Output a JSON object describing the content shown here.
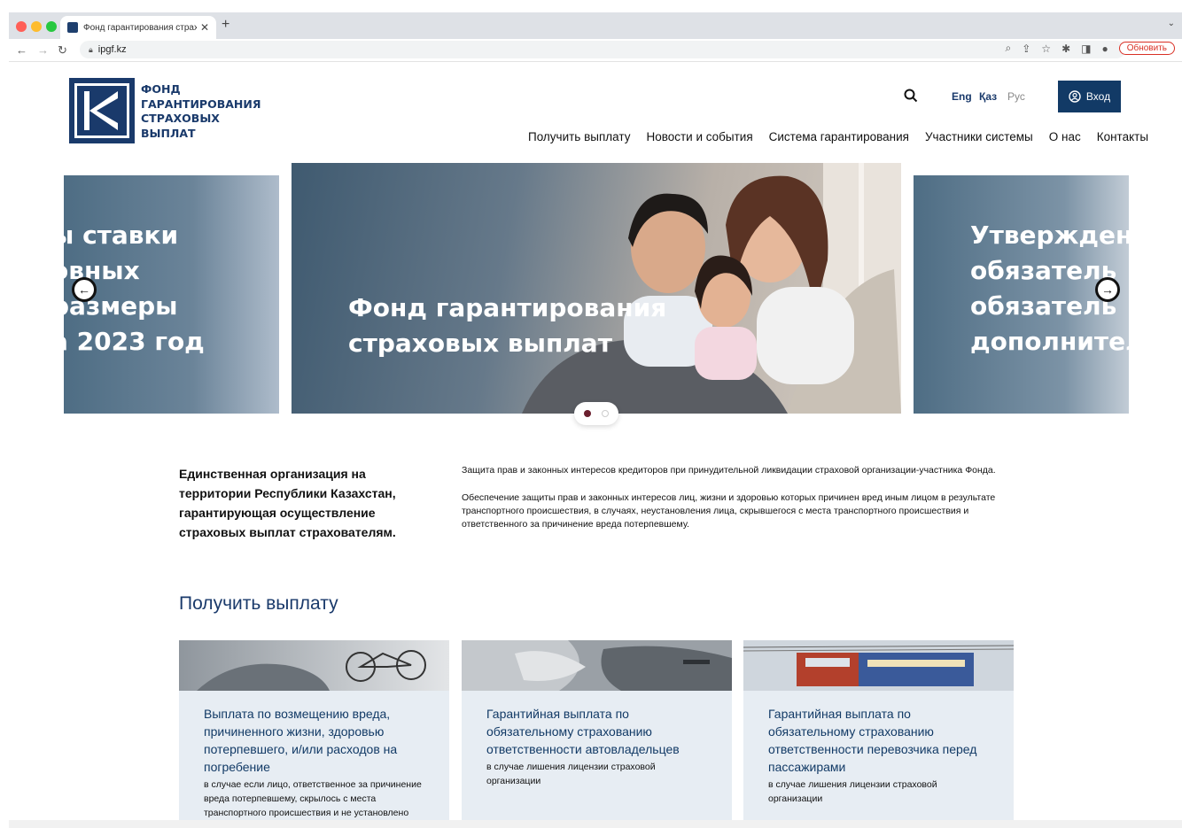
{
  "browser": {
    "tab_title": "Фонд гарантирования страх",
    "url": "ipgf.kz",
    "update_label": "Обновить"
  },
  "logo": {
    "line1": "ФОНД",
    "line2": "ГАРАНТИРОВАНИЯ",
    "line3": "СТРАХОВЫХ",
    "line4": "ВЫПЛАТ"
  },
  "languages": [
    "Eng",
    "Қаз",
    "Рус"
  ],
  "login_label": "Вход",
  "menu": [
    "Получить выплату",
    "Новости и события",
    "Система гарантирования",
    "Участники системы",
    "О нас",
    "Контакты"
  ],
  "carousel": {
    "left_lines": [
      "ы ставки",
      "овных",
      "размеры",
      "а 2023 год"
    ],
    "main_lines": [
      "Фонд гарантирования",
      "страховых выплат"
    ],
    "right_lines": [
      "Утвержден",
      "обязатель",
      "обязатель",
      "дополнител"
    ],
    "active_dot": 1
  },
  "intro": {
    "heading": "Единственная организация на территории Республики Казахстан, гарантирующая осуществление страховых выплат страхователям.",
    "para1": "Защита прав и законных интересов кредиторов при принудительной ликвидации страховой организации-участника Фонда.",
    "para2": "Обеспечение защиты прав и законных интересов лиц, жизни и здоровью которых причинен вред иным лицом в результате транспортного происшествия, в случаях, неустановления лица, скрывшегося с места транспортного происшествия и   ответственного за причинение вреда потерпевшему."
  },
  "section_title": "Получить выплату",
  "cards": [
    {
      "title": "Выплата по возмещению вреда, причиненного жизни, здоровью потерпевшего, и/или расходов на погребение",
      "subtitle": "в случае если лицо, ответственное за причинение вреда потерпевшему, скрылось с места транспортного происшествия и не установлено"
    },
    {
      "title": "Гарантийная выплата по обязательному страхованию ответственности автовладельцев",
      "subtitle": "в случае лишения лицензии страховой организации"
    },
    {
      "title": "Гарантийная выплата по обязательному страхованию ответственности перевозчика перед пассажирами",
      "subtitle": "в случае лишения лицензии страховой организации"
    }
  ],
  "colors": {
    "brand": "#1a3a6b",
    "button": "#123a66",
    "card_bg": "#e7edf3",
    "active_dot": "#6b1f2e"
  }
}
